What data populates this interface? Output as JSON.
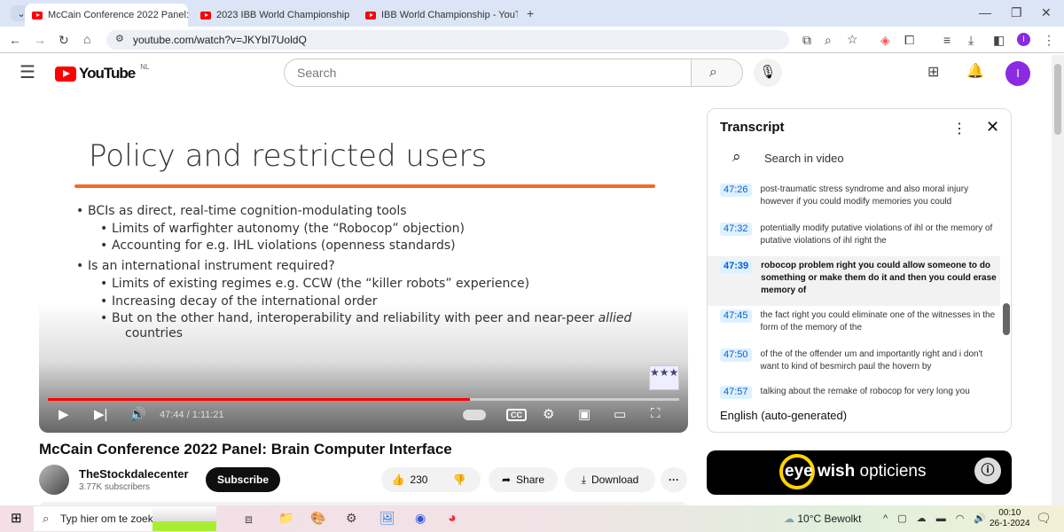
{
  "browser": {
    "tabs": [
      {
        "title": "McCain Conference 2022 Panel:"
      },
      {
        "title": "2023 IBB World Championship |"
      },
      {
        "title": "IBB World Championship - YouT"
      }
    ],
    "url": "youtube.com/watch?v=JKYbI7UoldQ"
  },
  "youtube": {
    "logo": "YouTube",
    "region": "NL",
    "search_placeholder": "Search",
    "avatar_letter": "I"
  },
  "video": {
    "slide_title": "Policy and restricted users",
    "bullets": [
      {
        "level": 1,
        "text": "BCIs as direct, real-time cognition-modulating tools"
      },
      {
        "level": 2,
        "text": "Limits of warfighter autonomy (the “Robocop” objection)"
      },
      {
        "level": 2,
        "text": "Accounting for e.g. IHL violations (openness standards)"
      },
      {
        "level": 1,
        "text": "Is an international instrument required?"
      },
      {
        "level": 2,
        "text": "Limits of existing regimes e.g. CCW (the “killer robots” experience)"
      },
      {
        "level": 2,
        "text": "Increasing decay of the international order"
      },
      {
        "level": 2,
        "text": "But on the other hand, interoperability and reliability with peer and near-peer allied"
      },
      {
        "level": 3,
        "text": "countries"
      }
    ],
    "time": "47:44 / 1:11:21",
    "progress": 0.669,
    "cc_label": "CC"
  },
  "title": "McCain Conference 2022 Panel: Brain Computer Interface",
  "channel": {
    "name": "TheStockdalecenter",
    "subscribers": "3.77K subscribers",
    "subscribe_label": "Subscribe"
  },
  "actions": {
    "likes": "230",
    "share": "Share",
    "download": "Download",
    "more": "···"
  },
  "transcript": {
    "title": "Transcript",
    "search_placeholder": "Search in video",
    "language": "English (auto-generated)",
    "segments": [
      {
        "time": "47:26",
        "text": "post-traumatic stress syndrome and also moral injury however if you could modify memories you could"
      },
      {
        "time": "47:32",
        "text": "potentially modify putative violations of ihl or the memory of putative violations of ihl right the"
      },
      {
        "time": "47:39",
        "text": "robocop problem right you could allow someone to do something or make them do it and then you could erase memory of",
        "active": true
      },
      {
        "time": "47:45",
        "text": "the fact right you could eliminate one of the witnesses in the form of the memory of the"
      },
      {
        "time": "47:50",
        "text": "of the of the offender um and importantly right and i don't want to kind of besmirch paul the hovern by"
      },
      {
        "time": "47:57",
        "text": "talking about the remake of robocop for very long you"
      }
    ]
  },
  "ad": {
    "brand": "eye",
    "brand2": "wish",
    "brand3": "opticiens"
  },
  "taskbar": {
    "search_placeholder": "Typ hier om te zoeken",
    "weather": "10°C  Bewolkt",
    "time": "00:10",
    "date": "26-1-2024"
  }
}
